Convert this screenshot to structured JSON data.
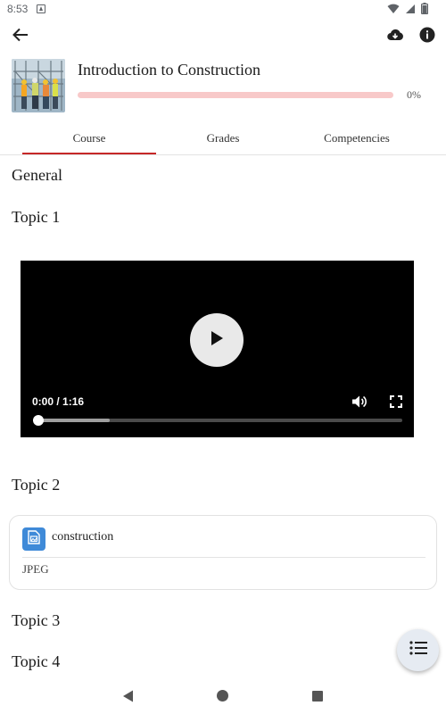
{
  "status_bar": {
    "time": "8:53"
  },
  "course": {
    "title": "Introduction to Construction",
    "progress_label": "0%",
    "progress_value": 0
  },
  "tabs": [
    {
      "label": "Course"
    },
    {
      "label": "Grades"
    },
    {
      "label": "Competencies"
    }
  ],
  "sections": {
    "general": "General",
    "topic1": "Topic 1",
    "topic2": "Topic 2",
    "topic3": "Topic 3",
    "topic4": "Topic 4"
  },
  "video": {
    "time": "0:00 / 1:16",
    "position_seconds": 0,
    "duration_seconds": 76,
    "buffered_fraction": 0.2
  },
  "resource": {
    "name": "construction",
    "type": "JPEG"
  },
  "colors": {
    "accent": "#c62828",
    "progress_track": "#f8c9c9",
    "resource_icon": "#3f8ad8",
    "fab_background": "#e6ebf2"
  },
  "icons": {
    "back": "arrow-left-icon",
    "download": "cloud-download-icon",
    "info": "info-icon",
    "play": "play-icon",
    "volume": "volume-icon",
    "fullscreen": "fullscreen-icon",
    "resource": "image-file-icon",
    "fab": "list-icon"
  }
}
